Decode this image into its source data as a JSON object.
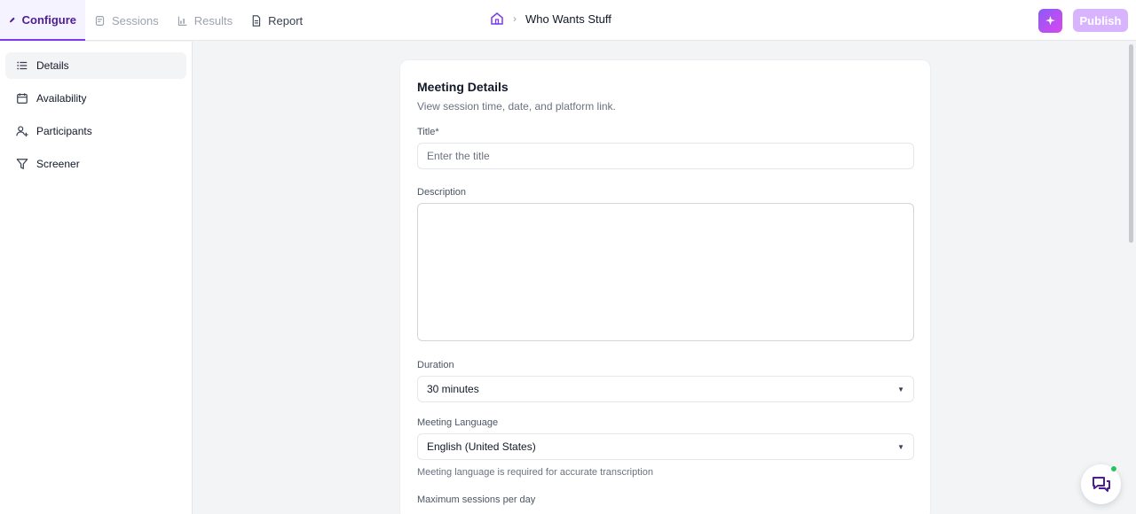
{
  "tabs": [
    {
      "label": "Configure",
      "icon": "pencil-icon"
    },
    {
      "label": "Sessions",
      "icon": "sessions-icon"
    },
    {
      "label": "Results",
      "icon": "chart-icon"
    },
    {
      "label": "Report",
      "icon": "document-icon"
    }
  ],
  "breadcrumb": {
    "home_icon": "home-icon",
    "project": "Who Wants Stuff"
  },
  "header": {
    "publish_label": "Publish",
    "magic_icon": "sparkle-icon"
  },
  "sidebar": {
    "items": [
      {
        "label": "Details",
        "icon": "list-icon"
      },
      {
        "label": "Availability",
        "icon": "calendar-icon"
      },
      {
        "label": "Participants",
        "icon": "user-plus-icon"
      },
      {
        "label": "Screener",
        "icon": "filter-icon"
      }
    ]
  },
  "form": {
    "title": "Meeting Details",
    "subtitle": "View session time, date, and platform link.",
    "title_label": "Title*",
    "title_placeholder": "Enter the title",
    "title_value": "",
    "description_label": "Description",
    "description_value": "",
    "duration_label": "Duration",
    "duration_value": "30 minutes",
    "language_label": "Meeting Language",
    "language_value": "English (United States)",
    "language_hint": "Meeting language is required for accurate transcription",
    "max_sessions_label": "Maximum sessions per day"
  },
  "colors": {
    "accent": "#7c3aed",
    "publish_bg": "#d8b4fe",
    "status_online": "#22c55e"
  }
}
